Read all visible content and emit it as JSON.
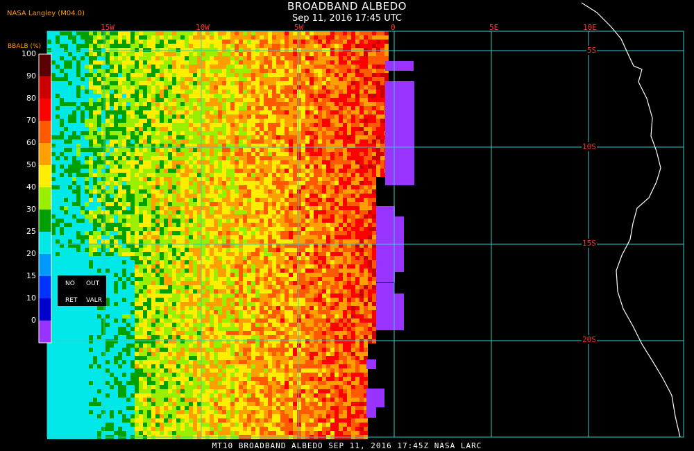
{
  "title": "BROADBAND ALBEDO",
  "subtitle": "Sep 11, 2016 17:45 UTC",
  "credit": "NASA Langley (M04.0)",
  "units_label": "BBALB (%)",
  "footer": "MT10  BROADBAND ALBEDO  SEP 11, 2016 17:45Z  NASA LARC",
  "colorbar": {
    "ticks": [
      "100",
      "90",
      "80",
      "70",
      "60",
      "50",
      "40",
      "30",
      "25",
      "20",
      "15",
      "10",
      "0"
    ],
    "colors": [
      "#5a0000",
      "#cc0000",
      "#ff0000",
      "#ff5a00",
      "#ffa000",
      "#ffee00",
      "#9aee00",
      "#00a000",
      "#00e8e8",
      "#0099ff",
      "#0033ff",
      "#0000cc",
      "#9933ff"
    ]
  },
  "legend": {
    "no": "NO",
    "out": "OUT",
    "ret": "RET",
    "valr": "VALR"
  },
  "longitude_labels": [
    "15W",
    "10W",
    "5W",
    "0",
    "5E",
    "10E"
  ],
  "latitude_labels": [
    "5S",
    "10S",
    "15S",
    "20S"
  ],
  "colors": {
    "grid": "#33cccc",
    "text_red": "#ff3333",
    "credit": "#ff9900",
    "coast": "#ffffff",
    "noretrieval": "#9933ff"
  }
}
